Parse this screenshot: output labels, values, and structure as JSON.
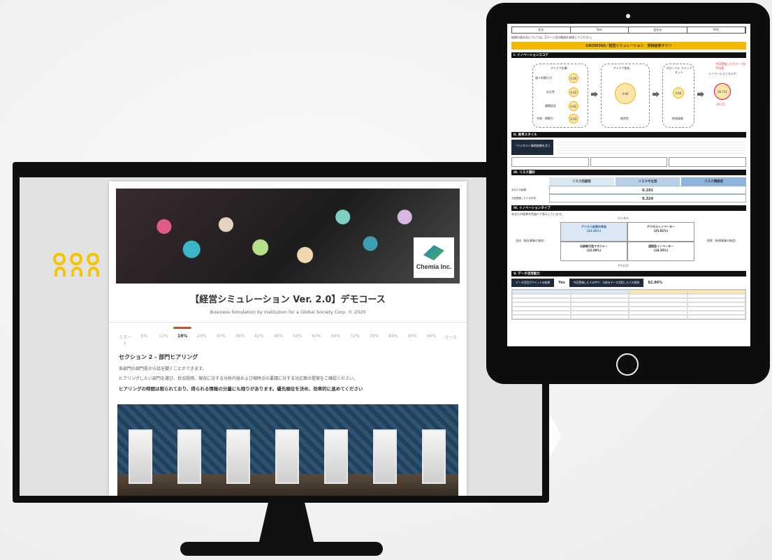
{
  "app": {
    "brand_name": "Chemia Inc.",
    "title": "【経営シミュレーション Ver. 2.0】デモコース",
    "subtitle": "Business Simulation by Institution for a Global Society Corp. © 2020",
    "progress": [
      "スタート",
      "6%",
      "12%",
      "18%",
      "24%",
      "30%",
      "36%",
      "42%",
      "48%",
      "54%",
      "60%",
      "66%",
      "72%",
      "78%",
      "84%",
      "90%",
      "96%",
      "ゴール"
    ],
    "progress_current": "18%",
    "section_title": "セクション 2 - 部門ヒアリング",
    "section_p1": "各部門の部門長から話を聞くことができます。",
    "section_p2": "ヒアリングしたい部門を選び、状況説明、現況に対する分析内容および現時点の要請に対する対応策の提案をご確認ください。",
    "section_bold": "ヒアリングの時間は限られており、得られる情報の分量にも限りがあります。優先順位を決め、効率的に進めてください",
    "door_count": 7
  },
  "report": {
    "header_cells": [
      "氏名",
      "Test",
      "会社名",
      "XXX"
    ],
    "note": "結果の読み方については、2ページ目の解説を参照してください。",
    "title": "GROW360／経営シミュレーション　受検結果サマリ",
    "sec1": "I. イノベーションスコア",
    "idea_box_title": "アイデア応募",
    "idea_items": [
      {
        "label": "個人的実行力",
        "value": "0.69"
      },
      {
        "label": "自立性",
        "value": "0.62"
      },
      {
        "label": "課題設定",
        "value": "0.62"
      },
      {
        "label": "共感・傾聴力",
        "value": "0.63"
      }
    ],
    "idea_gen_title": "アイデア創出",
    "idea_gen_value": "0.60",
    "idea_gen_caption": "創造性",
    "global_title": "グローバル マインドセット",
    "global_value": "0.64",
    "global_caption": "地域貢献",
    "score_title": "イノベーションスコア",
    "score_value": "30.731",
    "score_sub": "44.71",
    "legend": "今回受検したグループの平均値",
    "sec2": "II. 思考スタイル",
    "highlight": "「デジタル＋業務経験を活く",
    "sec3": "III. リスク選好",
    "risk_labels": [
      "リスク回避型",
      "リスク中立型",
      "リスク積極型"
    ],
    "risk_rows": [
      {
        "label": "あなたの結果",
        "value": "0.191"
      },
      {
        "label": "今回受検した人の平均",
        "value": "0.324"
      }
    ],
    "sec4": "IV. イノベーションタイプ",
    "itype_note": "あなたの結果を色抜けで表示しています。",
    "itype_top": "デジタル",
    "itype_bottom": "アナログ",
    "itype_left": "深化（既存事業の強化）",
    "itype_right": "探索（新規事業の創造）",
    "itype_cells": [
      {
        "name": "デジタル創業改革者",
        "pct": "(32.26%)"
      },
      {
        "name": "デジタルイノベーター",
        "pct": "(25.81%)"
      },
      {
        "name": "伝統執行型マネジャー",
        "pct": "(22.58%)"
      },
      {
        "name": "連続型イノベーター",
        "pct": "(19.35%)"
      }
    ],
    "sec5": "V. データ活用能力",
    "data_label": "データ活用がアメットの結果",
    "data_yes": "Yes",
    "data_pct_label": "今回受検した人の中で、分析をデータ活用した人の割合",
    "data_pct": "82.86%"
  },
  "colors": {
    "accent": "#f6c400",
    "progress": "#c0592d",
    "title_bar": "#f5b800"
  }
}
